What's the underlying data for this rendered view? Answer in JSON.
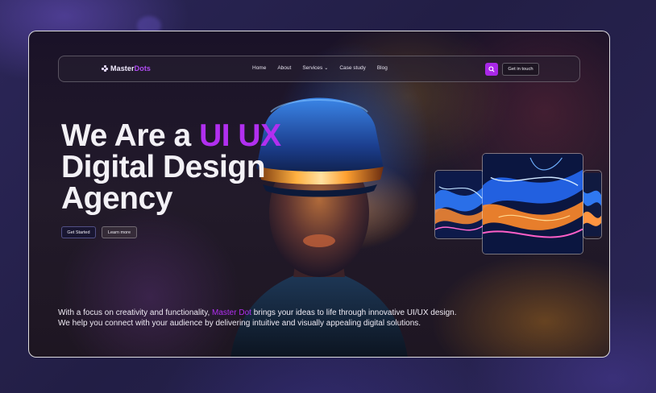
{
  "brand": {
    "name_prefix": "Master",
    "name_suffix": "Dots",
    "accent": "#b12ff0"
  },
  "nav": {
    "items": [
      {
        "label": "Home"
      },
      {
        "label": "About"
      },
      {
        "label": "Services",
        "chevron": "chevron-down-icon"
      },
      {
        "label": "Case study"
      },
      {
        "label": "Blog"
      }
    ],
    "search_icon": "search-icon",
    "cta_label": "Get in touch"
  },
  "hero": {
    "title_part1": "We Are a ",
    "title_accent": "UI UX",
    "title_line2": "Digital Design",
    "title_line3": "Agency",
    "primary_button": "Get Started",
    "secondary_button": "Learn more"
  },
  "tagline": {
    "before": "With a focus on creativity and functionality, ",
    "highlight": "Master Dot",
    "after": " brings your ideas to life through innovative UI/UX design.",
    "line2": "We help you connect with your audience by delivering intuitive and visually appealing digital solutions."
  },
  "colors": {
    "background": "#25214a",
    "accent": "#b12ff0",
    "button_bg": "#a927e8",
    "text": "#f3f1f6"
  }
}
